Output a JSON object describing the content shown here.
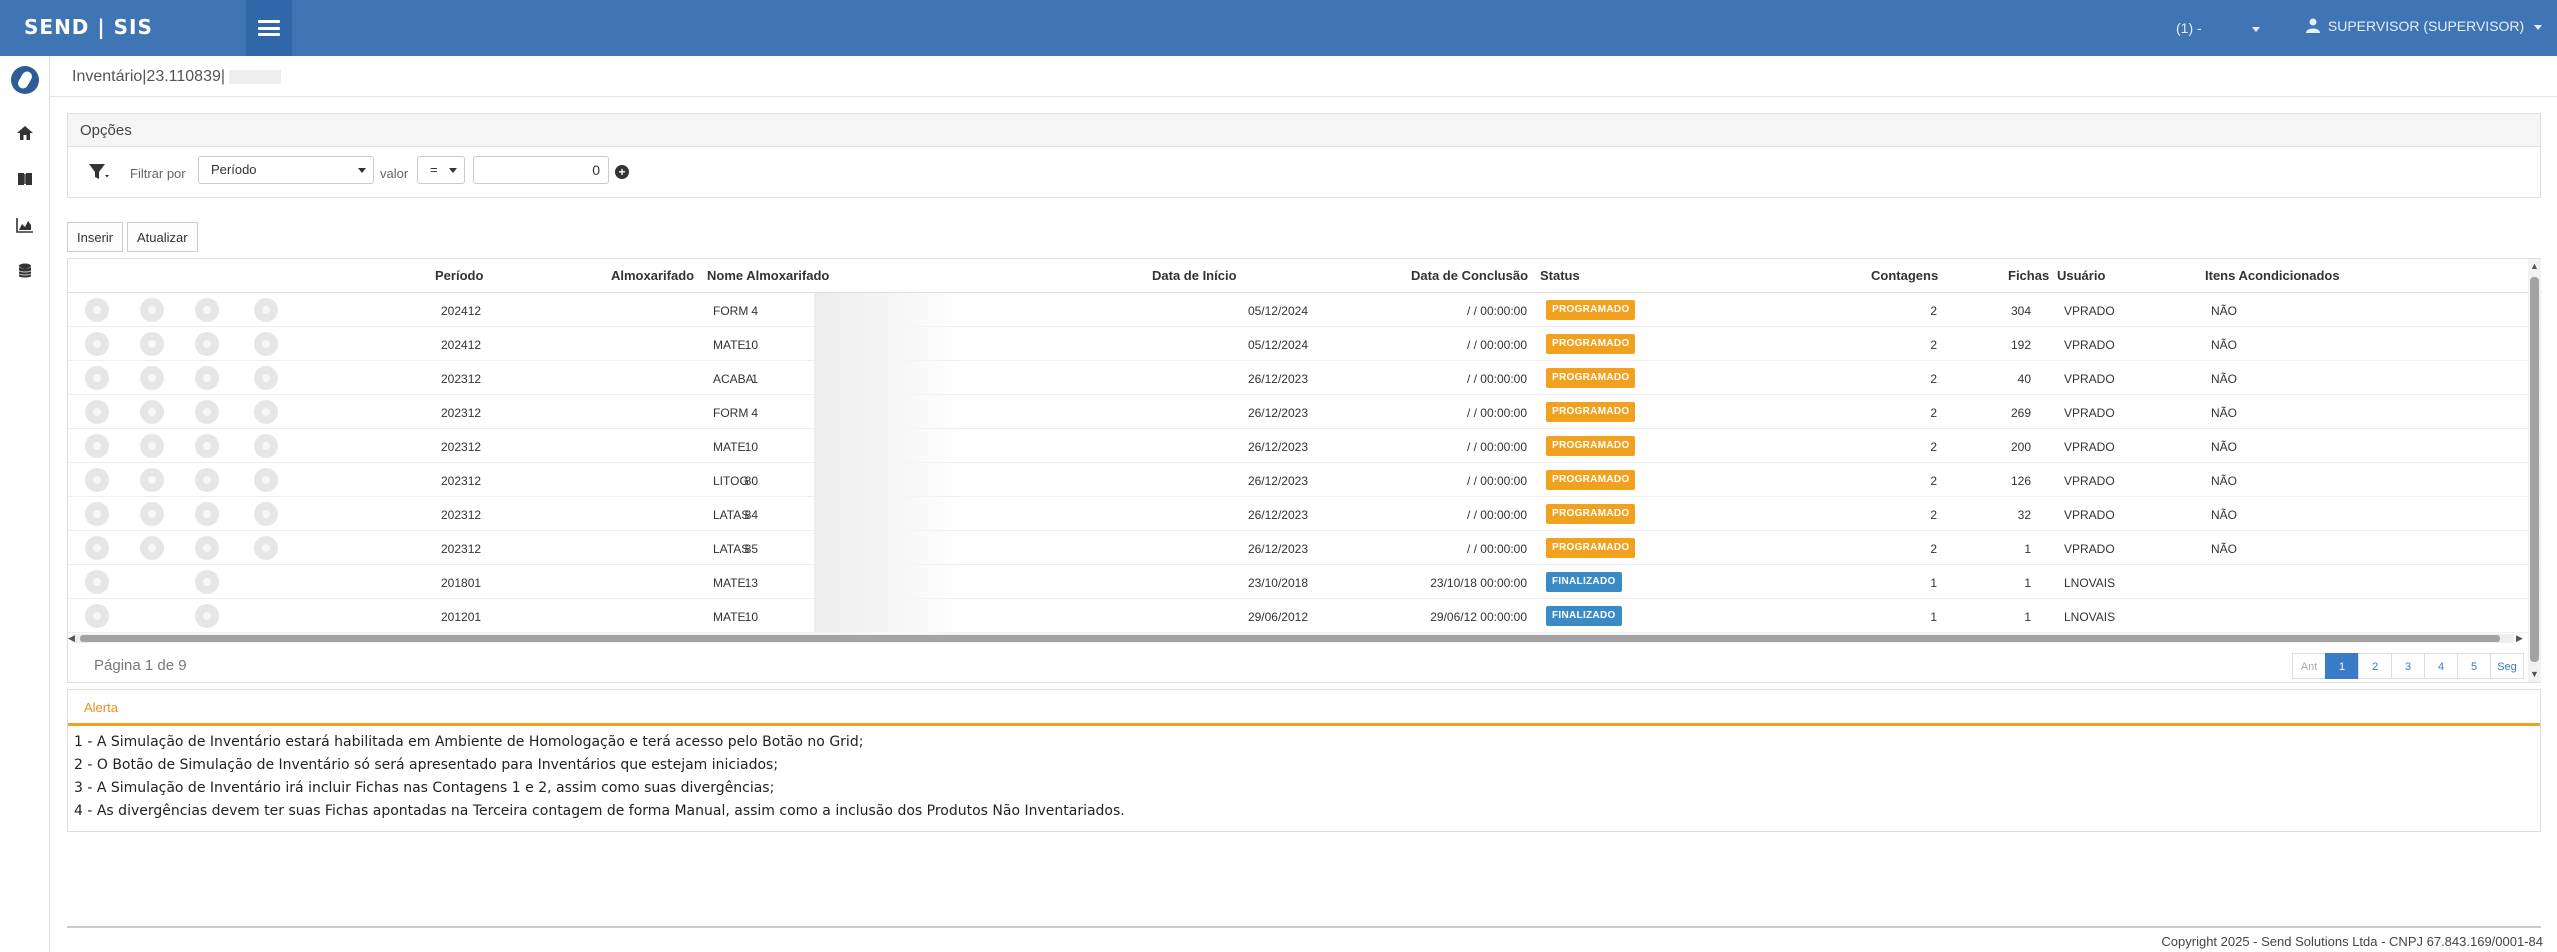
{
  "topbar": {
    "brand": "SEND | SIS",
    "company_select": "(1) -",
    "user": "SUPERVISOR (SUPERVISOR)"
  },
  "page": {
    "title": "Inventário|23.110839|"
  },
  "options": {
    "title": "Opções",
    "filter_label": "Filtrar por",
    "filter_field": "Período",
    "value_label": "valor",
    "operator": "=",
    "value": "0"
  },
  "toolbar": {
    "insert": "Inserir",
    "refresh": "Atualizar"
  },
  "grid": {
    "columns": [
      "Período",
      "Almoxarifado",
      "Nome Almoxarifado",
      "Data de Início",
      "Data de Conclusão",
      "Status",
      "Contagens",
      "Fichas",
      "Usuário",
      "Itens Acondicionados"
    ],
    "rows": [
      {
        "periodo": "202412",
        "almox": "4",
        "nome": "FORM",
        "inicio": "05/12/2024",
        "conclusao": "/ / 00:00:00",
        "status": "PROGRAMADO",
        "contagens": "2",
        "fichas": "304",
        "usuario": "VPRADO",
        "itens": "NÃO"
      },
      {
        "periodo": "202412",
        "almox": "10",
        "nome": "MATE",
        "inicio": "05/12/2024",
        "conclusao": "/ / 00:00:00",
        "status": "PROGRAMADO",
        "contagens": "2",
        "fichas": "192",
        "usuario": "VPRADO",
        "itens": "NÃO"
      },
      {
        "periodo": "202312",
        "almox": "1",
        "nome": "ACABA",
        "inicio": "26/12/2023",
        "conclusao": "/ / 00:00:00",
        "status": "PROGRAMADO",
        "contagens": "2",
        "fichas": "40",
        "usuario": "VPRADO",
        "itens": "NÃO"
      },
      {
        "periodo": "202312",
        "almox": "4",
        "nome": "FORM",
        "inicio": "26/12/2023",
        "conclusao": "/ / 00:00:00",
        "status": "PROGRAMADO",
        "contagens": "2",
        "fichas": "269",
        "usuario": "VPRADO",
        "itens": "NÃO"
      },
      {
        "periodo": "202312",
        "almox": "10",
        "nome": "MATE",
        "inicio": "26/12/2023",
        "conclusao": "/ / 00:00:00",
        "status": "PROGRAMADO",
        "contagens": "2",
        "fichas": "200",
        "usuario": "VPRADO",
        "itens": "NÃO"
      },
      {
        "periodo": "202312",
        "almox": "80",
        "nome": "LITOG",
        "inicio": "26/12/2023",
        "conclusao": "/ / 00:00:00",
        "status": "PROGRAMADO",
        "contagens": "2",
        "fichas": "126",
        "usuario": "VPRADO",
        "itens": "NÃO"
      },
      {
        "periodo": "202312",
        "almox": "84",
        "nome": "LATAS",
        "inicio": "26/12/2023",
        "conclusao": "/ / 00:00:00",
        "status": "PROGRAMADO",
        "contagens": "2",
        "fichas": "32",
        "usuario": "VPRADO",
        "itens": "NÃO"
      },
      {
        "periodo": "202312",
        "almox": "85",
        "nome": "LATAS",
        "inicio": "26/12/2023",
        "conclusao": "/ / 00:00:00",
        "status": "PROGRAMADO",
        "contagens": "2",
        "fichas": "1",
        "usuario": "VPRADO",
        "itens": "NÃO"
      },
      {
        "periodo": "201801",
        "almox": "13",
        "nome": "MATE",
        "inicio": "23/10/2018",
        "conclusao": "23/10/18 00:00:00",
        "status": "FINALIZADO",
        "contagens": "1",
        "fichas": "1",
        "usuario": "LNOVAIS",
        "itens": ""
      },
      {
        "periodo": "201201",
        "almox": "10",
        "nome": "MATE",
        "inicio": "29/06/2012",
        "conclusao": "29/06/12 00:00:00",
        "status": "FINALIZADO",
        "contagens": "1",
        "fichas": "1",
        "usuario": "LNOVAIS",
        "itens": ""
      }
    ],
    "status_colors": {
      "PROGRAMADO": "#f0a21f",
      "FINALIZADO": "#3a8ac4"
    }
  },
  "pager": {
    "info": "Página 1 de 9",
    "prev": "Ant",
    "pages": [
      "1",
      "2",
      "3",
      "4",
      "5"
    ],
    "next": "Seg"
  },
  "alert": {
    "title": "Alerta",
    "lines": [
      "1 - A Simulação de Inventário estará habilitada em Ambiente de Homologação e terá acesso pelo Botão no Grid;",
      "2 - O Botão de Simulação de Inventário só será apresentado para Inventários que estejam iniciados;",
      "3 - A Simulação de Inventário irá incluir Fichas nas Contagens 1 e 2, assim como suas divergências;",
      "4 - As divergências devem ter suas Fichas apontadas na Terceira contagem de forma Manual, assim como a inclusão dos Produtos Não Inventariados."
    ]
  },
  "footer": {
    "text": "Copyright 2025 - Send Solutions Ltda - CNPJ 67.843.169/0001-84"
  },
  "colors": {
    "topbar": "#3f75b5",
    "accent": "#3a7bc8",
    "warning": "#f0a21f"
  }
}
